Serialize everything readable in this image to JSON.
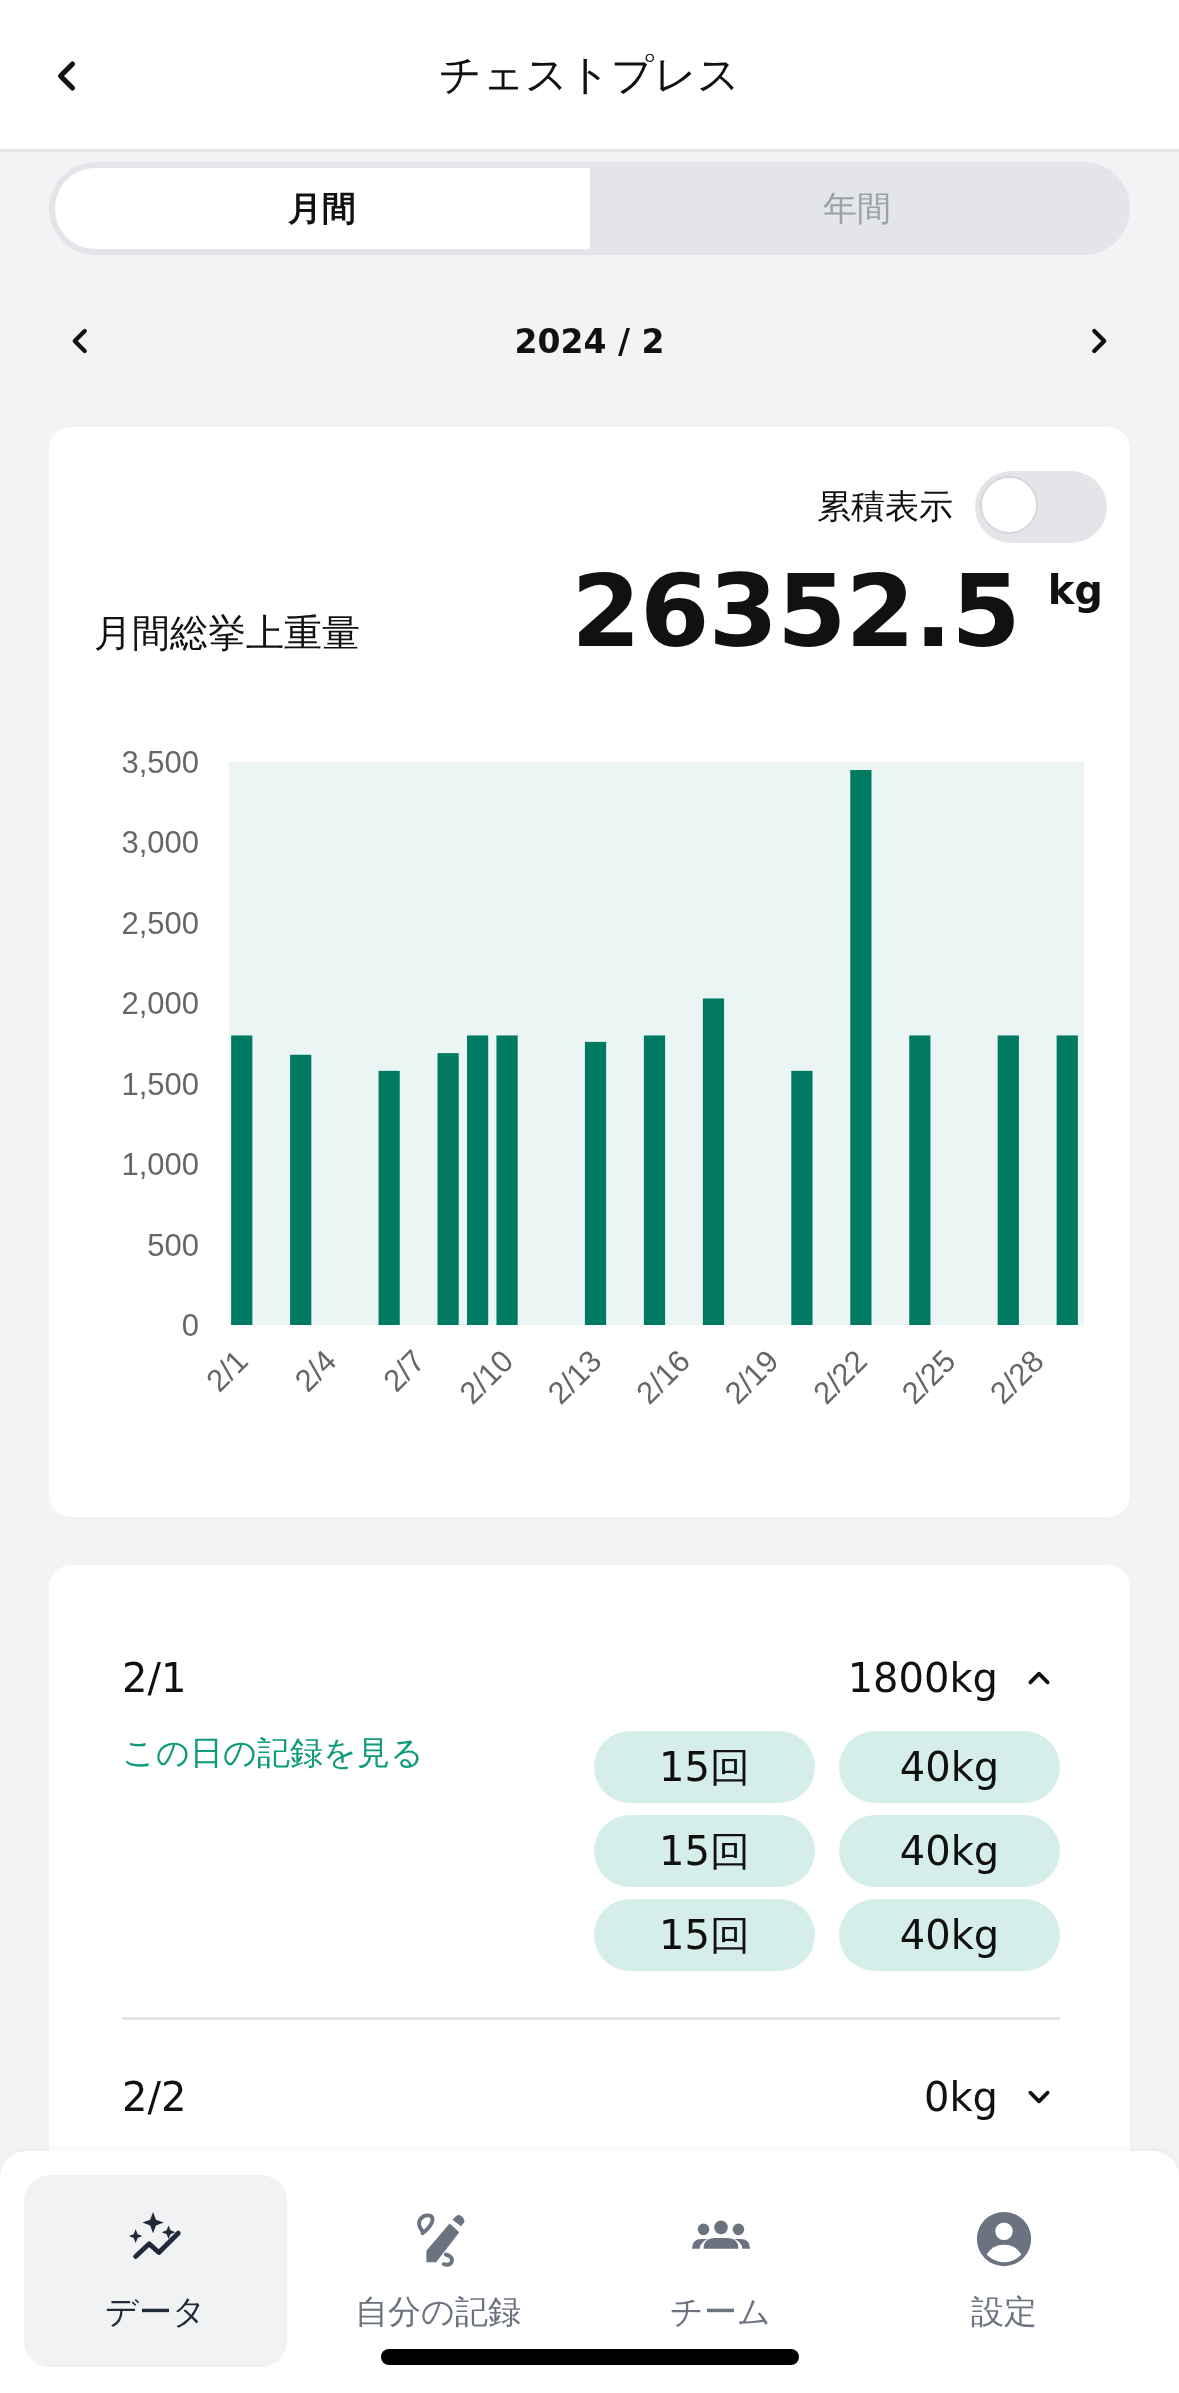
{
  "header": {
    "title": "チェストプレス"
  },
  "period_tabs": [
    {
      "label": "月間",
      "selected": true
    },
    {
      "label": "年間",
      "selected": false
    }
  ],
  "month_nav": {
    "label": "2024 / 2"
  },
  "summary": {
    "cumulative_toggle": {
      "label": "累積表示",
      "on": false
    },
    "total_label": "月間総挙上重量",
    "total_value": "26352.5",
    "unit": "kg",
    "chart_data": {
      "type": "bar",
      "categories": [
        "2/1",
        null,
        null,
        "2/4",
        null,
        null,
        "2/7",
        null,
        null,
        "2/10",
        null,
        null,
        "2/13",
        null,
        null,
        "2/16",
        null,
        null,
        "2/19",
        null,
        null,
        "2/22",
        null,
        null,
        "2/25",
        null,
        null,
        "2/28",
        null
      ],
      "series": [
        {
          "color": "#007a62",
          "values": [
            1800,
            null,
            1680,
            null,
            null,
            1580,
            null,
            1690,
            1800,
            1800,
            null,
            null,
            1760,
            null,
            1800,
            null,
            2030,
            null,
            null,
            1580,
            null,
            3450,
            null,
            1800,
            null,
            null,
            1800,
            null,
            1800
          ]
        }
      ],
      "ylim": [
        0,
        3500
      ],
      "yticks": [
        {
          "value": 0,
          "label": "0"
        },
        {
          "value": 500,
          "label": "500"
        },
        {
          "value": 1000,
          "label": "1,000"
        },
        {
          "value": 1500,
          "label": "1,500"
        },
        {
          "value": 2000,
          "label": "2,000"
        },
        {
          "value": 2500,
          "label": "2,500"
        },
        {
          "value": 3000,
          "label": "3,000"
        },
        {
          "value": 3500,
          "label": "3,500"
        }
      ]
    }
  },
  "days": [
    {
      "date": "2/1",
      "total": "1800kg",
      "expanded": true,
      "link": "この日の記録を見る",
      "sets": [
        {
          "reps": "15回",
          "weight": "40kg"
        },
        {
          "reps": "15回",
          "weight": "40kg"
        },
        {
          "reps": "15回",
          "weight": "40kg"
        }
      ]
    },
    {
      "date": "2/2",
      "total": "0kg",
      "expanded": false
    }
  ],
  "bottom_nav": [
    {
      "label": "データ",
      "kind": "data",
      "selected": true
    },
    {
      "label": "自分の記録",
      "kind": "record",
      "selected": false
    },
    {
      "label": "チーム",
      "kind": "team",
      "selected": false
    },
    {
      "label": "設定",
      "kind": "settings",
      "selected": false
    }
  ]
}
